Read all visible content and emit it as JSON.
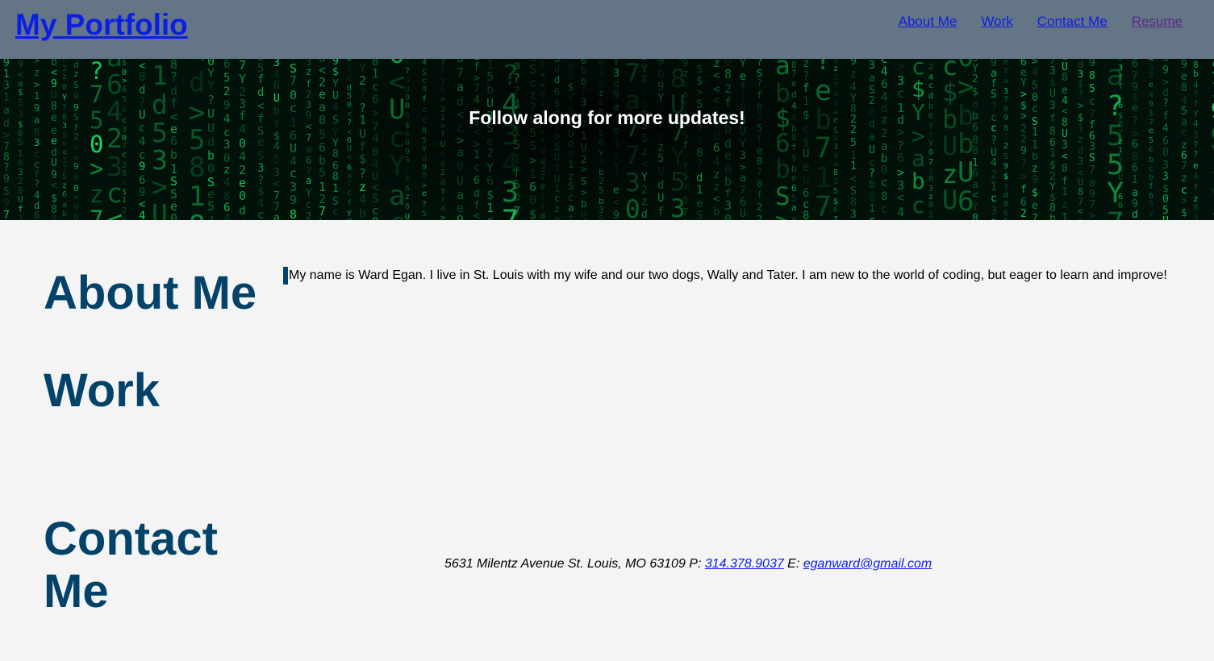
{
  "header": {
    "brand": "My Portfolio",
    "nav": [
      {
        "label": "About Me"
      },
      {
        "label": "Work"
      },
      {
        "label": "Contact Me"
      },
      {
        "label": "Resume",
        "state": "visited"
      }
    ],
    "colors": {
      "background": "#647585",
      "link": "#0b1ee6",
      "visited": "#5a2a8c"
    }
  },
  "hero": {
    "text": "Follow along for more updates!",
    "background": "green matrix code rain on black"
  },
  "sections": {
    "about": {
      "heading": "About Me",
      "body": "My name is Ward Egan. I live in St. Louis with my wife and our two dogs, Wally and Tater. I am new to the world of coding, but eager to learn and improve!"
    },
    "work": {
      "heading": "Work"
    },
    "contact": {
      "heading": "Contact Me",
      "address": "5631 Milentz Avenue St. Louis, MO 63109 ",
      "phone_prefix": "P: ",
      "phone": "314.378.9037",
      "email_prefix": " E: ",
      "email": "eganward@gmail.com"
    }
  },
  "colors": {
    "heading": "#044369",
    "page_background": "#f4f4f4"
  }
}
